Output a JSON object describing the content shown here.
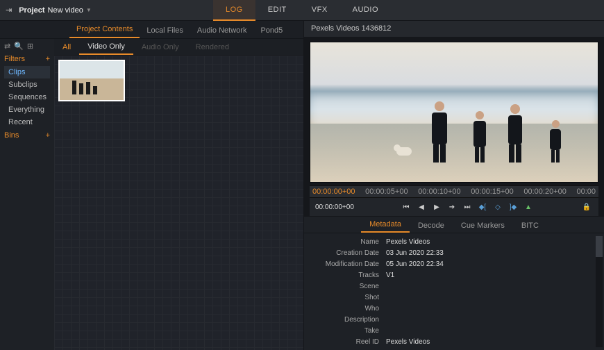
{
  "header": {
    "project_label": "Project",
    "project_name": "New video",
    "tabs": [
      "LOG",
      "EDIT",
      "VFX",
      "AUDIO"
    ],
    "active_tab": "LOG"
  },
  "left": {
    "panel_tabs": [
      "Project Contents",
      "Local Files",
      "Audio Network",
      "Pond5"
    ],
    "active_panel": "Project Contents",
    "sidebar": {
      "filters_label": "Filters",
      "items": [
        "Clips",
        "Subclips",
        "Sequences",
        "Everything",
        "Recent"
      ],
      "active_item": "Clips",
      "bins_label": "Bins"
    },
    "filter_row": [
      "All",
      "Video Only",
      "Audio Only",
      "Rendered"
    ],
    "filter_selected": "All",
    "filter_active": "Video Only"
  },
  "viewer": {
    "title": "Pexels Videos 1436812",
    "timeline_marks": [
      "00:00:00+00",
      "00:00:05+00",
      "00:00:10+00",
      "00:00:15+00",
      "00:00:20+00",
      "00:00"
    ],
    "timecode": "00:00:00+00"
  },
  "metadata": {
    "tabs": [
      "Metadata",
      "Decode",
      "Cue Markers",
      "BITC"
    ],
    "active_tab": "Metadata",
    "rows": [
      {
        "label": "Name",
        "value": "Pexels Videos"
      },
      {
        "label": "Creation Date",
        "value": "03 Jun 2020  22:33"
      },
      {
        "label": "Modification Date",
        "value": "05 Jun 2020  22:34"
      },
      {
        "label": "Tracks",
        "value": "V1"
      },
      {
        "label": "Scene",
        "value": ""
      },
      {
        "label": "Shot",
        "value": ""
      },
      {
        "label": "Who",
        "value": ""
      },
      {
        "label": "Description",
        "value": ""
      },
      {
        "label": "Take",
        "value": ""
      },
      {
        "label": "Reel ID",
        "value": "Pexels Videos"
      }
    ]
  }
}
